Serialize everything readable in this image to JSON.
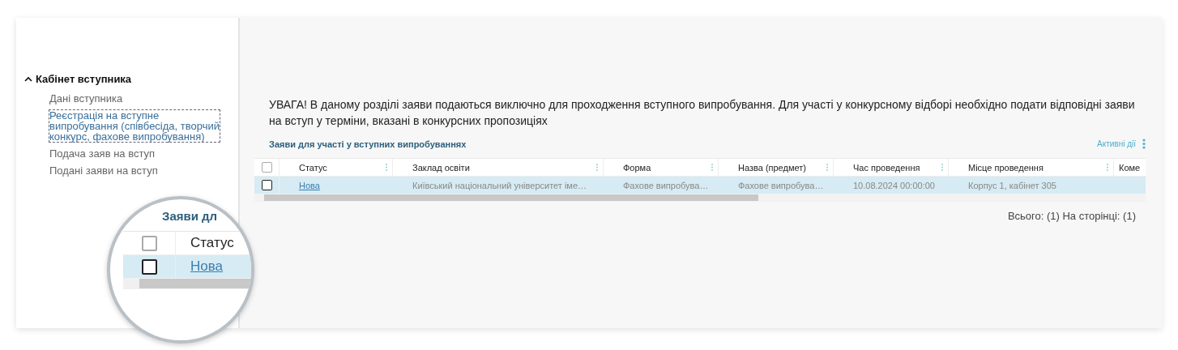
{
  "sidebar": {
    "section": {
      "label": "Кабінет вступника",
      "expanded": true,
      "items": [
        {
          "label": "Дані вступника",
          "selected": false
        },
        {
          "label": "Реєстрація на вступне випробування (співбесіда, творчий конкурс, фахове випробування)",
          "selected": true
        },
        {
          "label": "Подача заяв на вступ",
          "selected": false
        },
        {
          "label": "Подані заяви на вступ",
          "selected": false
        }
      ]
    }
  },
  "notice": "УВАГА! В даному розділі заяви подаються виключно для проходження вступного випробування. Для участі у конкурсному відборі необхідно подати відповідні заяви на вступ у терміни, вказані в конкурсних пропозиціях",
  "section_title": "Заяви для участі у вступних випробуваннях",
  "actions": {
    "label": "Активні дії"
  },
  "table": {
    "header_checked": false,
    "columns": [
      "Статус",
      "Заклад освіти",
      "Форма",
      "Назва (предмет)",
      "Час проведення",
      "Місце проведення",
      "Коме"
    ],
    "rows": [
      {
        "checked": false,
        "selected": true,
        "cells": [
          "Нова",
          "Київський національний університет іме…",
          "Фахове випробува…",
          "Фахове випробува…",
          "10.08.2024 00:00:00",
          "Корпус 1, кабінет 305"
        ]
      }
    ]
  },
  "footer": "Всього: (1) На сторінці: (1)",
  "magnifier": {
    "title": "Заяви дл",
    "column": "Статус",
    "status": "Нова",
    "header_checked": false,
    "row_checked": false,
    "row_selected": true
  }
}
